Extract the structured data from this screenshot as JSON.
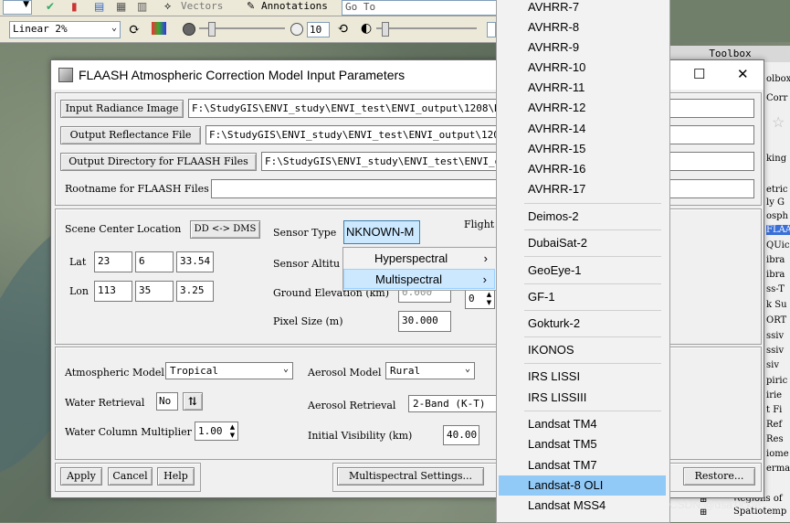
{
  "toolbar": {
    "vectors_label": "Vectors",
    "annotations_label": "Annotations",
    "goto_value": "Go To",
    "stretch_value": "Linear 2%",
    "zoom_value": "10"
  },
  "toolbox": {
    "title": "Toolbox",
    "items": [
      "olbox",
      "Corr",
      "king",
      "etric",
      "ly G",
      "osph",
      "FLAA",
      "QUic",
      "ibra",
      "ibra",
      "ss-T",
      "k Su",
      "ORT",
      "ssiv",
      "ssiv",
      "siv",
      "piric",
      "irie",
      "t Fi",
      "Ref",
      "Res",
      "iome",
      "ermal",
      "Regions of",
      "Spatiotemp"
    ]
  },
  "dialog": {
    "title": "FLAASH Atmospheric Correction Model Input Parameters",
    "maximize_glyph": "☐",
    "close_glyph": "✕",
    "input_radiance_label": "Input Radiance Image",
    "input_radiance_value": "F:\\StudyGIS\\ENVI_study\\ENVI_test\\ENVI_output\\1208\\Radio",
    "output_reflectance_label": "Output Reflectance File",
    "output_reflectance_value": "F:\\StudyGIS\\ENVI_study\\ENVI_test\\ENVI_output\\1208\\Re",
    "output_directory_label": "Output Directory for FLAASH Files",
    "output_directory_value": "F:\\StudyGIS\\ENVI_study\\ENVI_test\\ENVI_outp",
    "rootname_label": "Rootname for FLAASH Files",
    "rootname_value": "",
    "scene_center_label": "Scene Center Location",
    "dd_dms_label": "DD <-> DMS",
    "lat_label": "Lat",
    "lat": [
      "23",
      "6",
      "33.54"
    ],
    "lon_label": "Lon",
    "lon": [
      "113",
      "35",
      "3.25"
    ],
    "sensor_type_label": "Sensor Type",
    "sensor_type_value": "NKNOWN-M",
    "sensor_altitude_label": "Sensor Altitu",
    "ground_elevation_label": "Ground Elevation (km)",
    "ground_elevation_value": "0.000",
    "pixel_size_label": "Pixel Size (m)",
    "pixel_size_value": "30.000",
    "flight_label": "Flight",
    "flight_value": "0",
    "atmospheric_model_label": "Atmospheric Model",
    "atmospheric_model_value": "Tropical",
    "aerosol_model_label": "Aerosol Model",
    "aerosol_model_value": "Rural",
    "water_retrieval_label": "Water Retrieval",
    "water_retrieval_value": "No",
    "aerosol_retrieval_label": "Aerosol Retrieval",
    "aerosol_retrieval_value": "2-Band (K-T)",
    "water_column_label": "Water Column Multiplier",
    "water_column_value": "1.00",
    "initial_visibility_label": "Initial Visibility (km)",
    "initial_visibility_value": "40.00",
    "apply_label": "Apply",
    "cancel_label": "Cancel",
    "help_label": "Help",
    "multispectral_settings_label": "Multispectral Settings...",
    "restore_label": "Restore..."
  },
  "submenu": {
    "items": [
      {
        "label": "Hyperspectral",
        "active": false
      },
      {
        "label": "Multispectral",
        "active": true
      }
    ]
  },
  "sensor_list": {
    "items": [
      "AVHRR-7",
      "AVHRR-8",
      "AVHRR-9",
      "AVHRR-10",
      "AVHRR-11",
      "AVHRR-12",
      "AVHRR-14",
      "AVHRR-15",
      "AVHRR-16",
      "AVHRR-17",
      "Deimos-2",
      "DubaiSat-2",
      "GeoEye-1",
      "GF-1",
      "Gokturk-2",
      "IKONOS",
      "IRS LISSI",
      "IRS LISSIII",
      "Landsat TM4",
      "Landsat TM5",
      "Landsat TM7",
      "Landsat-8 OLI",
      "Landsat MSS4"
    ],
    "selected": "Landsat-8 OLI"
  },
  "watermark": "CSDN @dsaTickle"
}
